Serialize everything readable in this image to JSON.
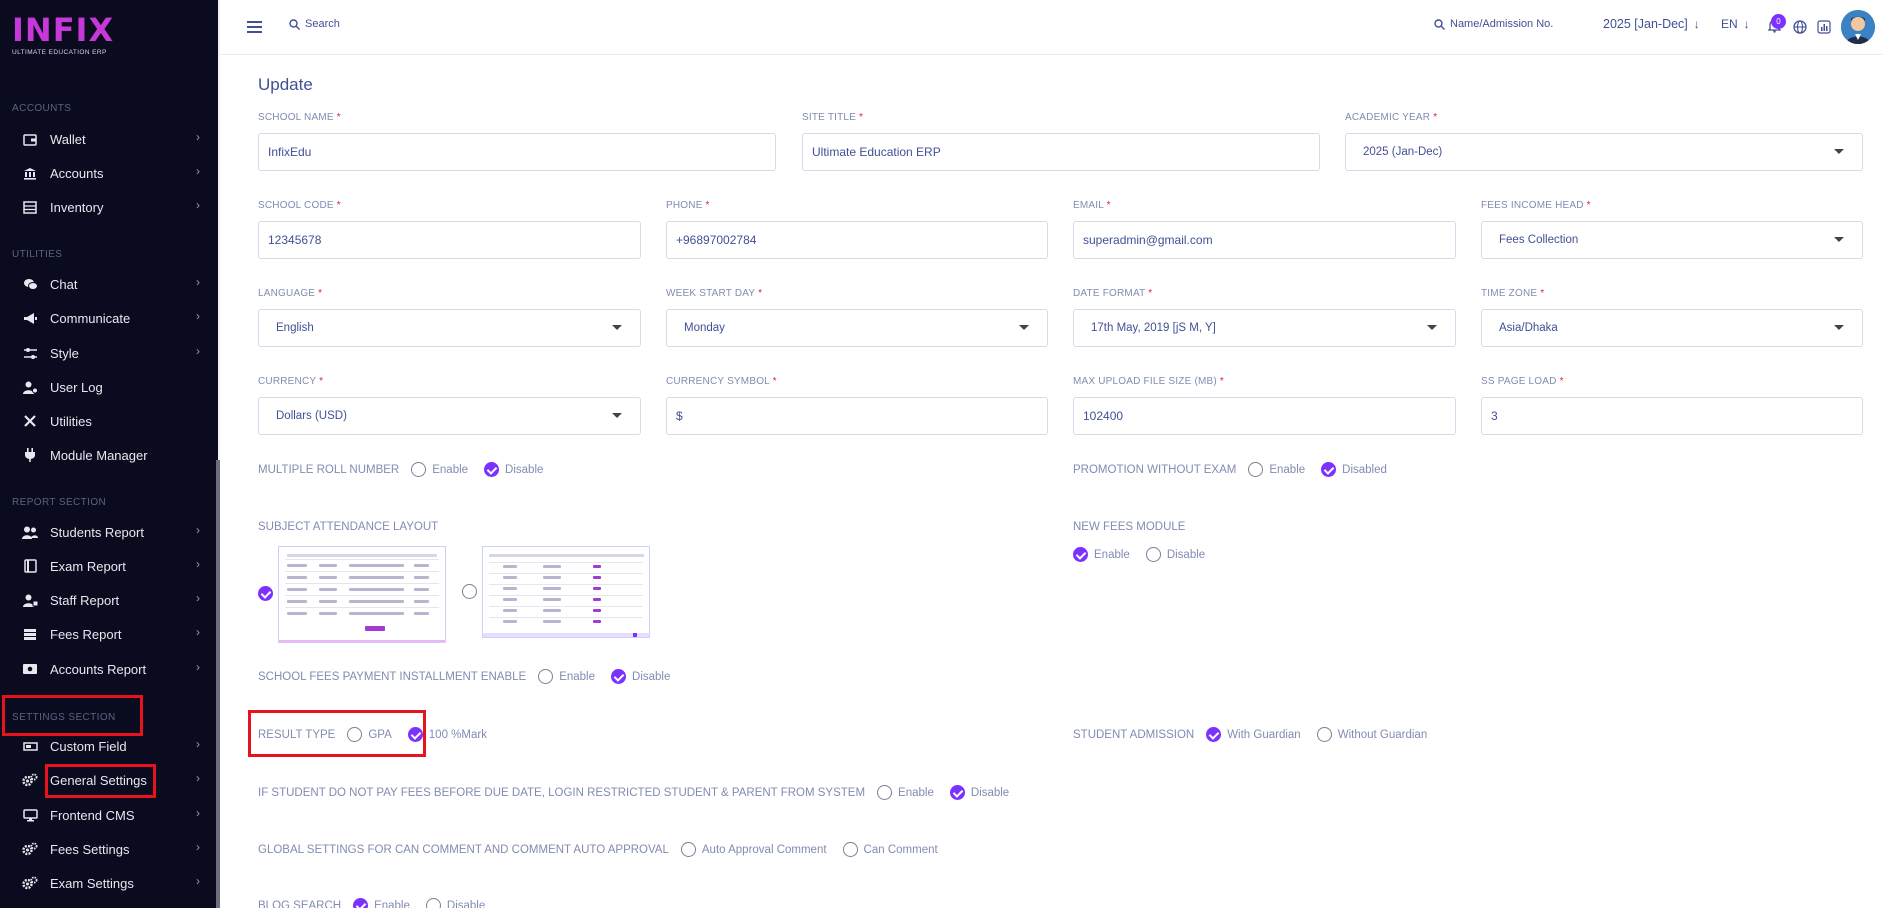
{
  "sidebar": {
    "logo": {
      "brand": "INFIX",
      "tagline": "ULTIMATE EDUCATION ERP"
    },
    "sections": {
      "accounts": "ACCOUNTS",
      "utilities": "UTILITIES",
      "report": "REPORT SECTION",
      "settings": "SETTINGS SECTION"
    },
    "items": {
      "wallet": "Wallet",
      "accounts": "Accounts",
      "inventory": "Inventory",
      "chat": "Chat",
      "communicate": "Communicate",
      "style": "Style",
      "user_log": "User Log",
      "utilities": "Utilities",
      "module_manager": "Module Manager",
      "students_report": "Students Report",
      "exam_report": "Exam Report",
      "staff_report": "Staff Report",
      "fees_report": "Fees Report",
      "accounts_report": "Accounts Report",
      "custom_field": "Custom Field",
      "general_settings": "General Settings",
      "frontend_cms": "Frontend CMS",
      "fees_settings": "Fees Settings",
      "exam_settings": "Exam Settings"
    }
  },
  "topbar": {
    "search_label": "Search",
    "student_search_label": "Name/Admission No.",
    "academic_year": "2025 [Jan-Dec]",
    "language": "EN",
    "notification_count": "0"
  },
  "form": {
    "title": "Update",
    "school_name": {
      "label": "SCHOOL NAME",
      "value": "InfixEdu"
    },
    "site_title": {
      "label": "SITE TITLE",
      "value": "Ultimate Education ERP"
    },
    "academic_year": {
      "label": "ACADEMIC YEAR",
      "value": "2025 (Jan-Dec)"
    },
    "school_code": {
      "label": "SCHOOL CODE",
      "value": "12345678"
    },
    "phone": {
      "label": "PHONE",
      "value": "+96897002784"
    },
    "email": {
      "label": "EMAIL",
      "value": "superadmin@gmail.com"
    },
    "fees_income_head": {
      "label": "FEES INCOME HEAD",
      "value": "Fees Collection"
    },
    "language": {
      "label": "LANGUAGE",
      "value": "English"
    },
    "week_start_day": {
      "label": "WEEK START DAY",
      "value": "Monday"
    },
    "date_format": {
      "label": "DATE FORMAT",
      "value": "17th May, 2019 [jS M, Y]"
    },
    "time_zone": {
      "label": "TIME ZONE",
      "value": "Asia/Dhaka"
    },
    "currency": {
      "label": "CURRENCY",
      "value": "Dollars (USD)"
    },
    "currency_symbol": {
      "label": "CURRENCY SYMBOL",
      "value": "$"
    },
    "max_upload": {
      "label": "MAX UPLOAD FILE SIZE (MB)",
      "value": "102400"
    },
    "ss_page_load": {
      "label": "SS PAGE LOAD",
      "value": "3"
    },
    "multiple_roll": {
      "label": "MULTIPLE ROLL NUMBER",
      "opt1": "Enable",
      "opt2": "Disable",
      "selected": "Disable"
    },
    "promotion": {
      "label": "PROMOTION WITHOUT EXAM",
      "opt1": "Enable",
      "opt2": "Disabled",
      "selected": "Disabled"
    },
    "subject_attendance": {
      "label": "SUBJECT ATTENDANCE LAYOUT",
      "selected": 1
    },
    "new_fees": {
      "label": "NEW FEES MODULE",
      "opt1": "Enable",
      "opt2": "Disable",
      "selected": "Enable"
    },
    "installment": {
      "label": "SCHOOL FEES PAYMENT INSTALLMENT ENABLE",
      "opt1": "Enable",
      "opt2": "Disable",
      "selected": "Disable"
    },
    "result_type": {
      "label": "RESULT TYPE",
      "opt1": "GPA",
      "opt2": "100 %Mark",
      "selected": "100 %Mark"
    },
    "student_admission": {
      "label": "STUDENT ADMISSION",
      "opt1": "With Guardian",
      "opt2": "Without Guardian",
      "selected": "With Guardian"
    },
    "login_restrict": {
      "label": "IF STUDENT DO NOT PAY FEES BEFORE DUE DATE, LOGIN RESTRICTED STUDENT & PARENT FROM SYSTEM",
      "opt1": "Enable",
      "opt2": "Disable",
      "selected": "Disable"
    },
    "comment": {
      "label": "GLOBAL SETTINGS FOR CAN COMMENT AND COMMENT AUTO APPROVAL",
      "opt1": "Auto Approval Comment",
      "opt2": "Can Comment",
      "selected": ""
    },
    "blog_search": {
      "label": "BLOG SEARCH",
      "opt1": "Enable",
      "opt2": "Disable",
      "selected": "Enable"
    }
  },
  "colors": {
    "accent": "#7c32ff",
    "sidebar_bg": "#0b0b1f",
    "highlight": "#e8121d",
    "required": "#e01b40"
  }
}
